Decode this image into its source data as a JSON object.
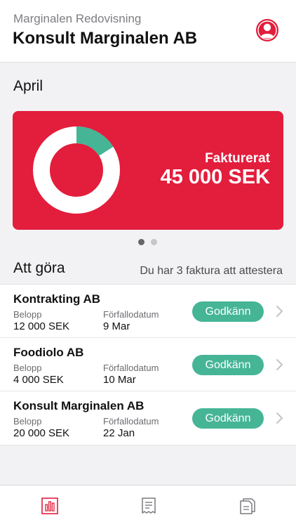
{
  "header": {
    "subtitle": "Marginalen Redovisning",
    "title": "Konsult Marginalen AB",
    "profile_icon": "user-circle-icon"
  },
  "overview": {
    "month": "April",
    "card_label": "Fakturerat",
    "card_amount": "45 000 SEK",
    "donut_fraction": 0.16,
    "colors": {
      "card": "#e31d3c",
      "ring": "#ffffff",
      "segment": "#45b596"
    },
    "pages": 2,
    "active_page": 1
  },
  "todo": {
    "title": "Att göra",
    "summary": "Du har 3 faktura att attestera",
    "amount_label": "Belopp",
    "due_label": "Förfallodatum",
    "approve_label": "Godkänn",
    "items": [
      {
        "company": "Kontrakting AB",
        "amount": "12 000 SEK",
        "due": "9 Mar"
      },
      {
        "company": "Foodiolo AB",
        "amount": "4 000 SEK",
        "due": "10 Mar"
      },
      {
        "company": "Konsult Marginalen AB",
        "amount": "20 000 SEK",
        "due": "22 Jan"
      }
    ]
  },
  "tabbar": {
    "tabs": [
      {
        "icon": "bar-chart-icon",
        "active": true
      },
      {
        "icon": "receipt-icon",
        "active": false
      },
      {
        "icon": "documents-icon",
        "active": false
      }
    ],
    "colors": {
      "active": "#e31d3c",
      "inactive": "#7a7a7f"
    }
  }
}
